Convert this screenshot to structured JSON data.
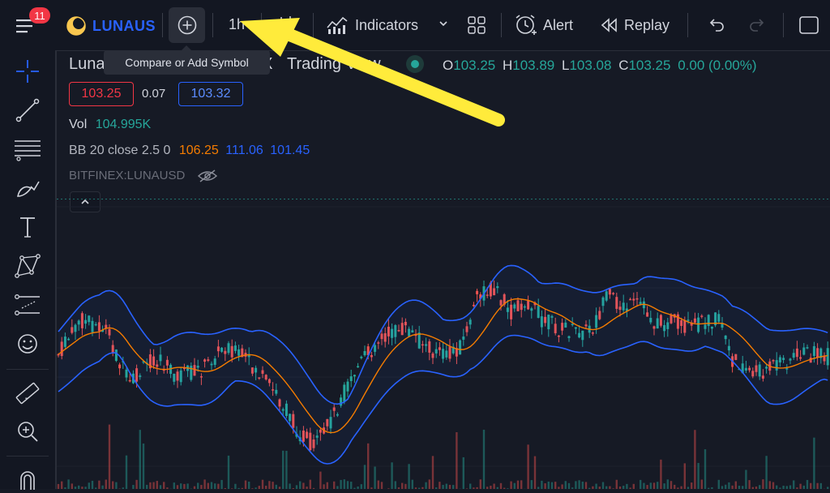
{
  "header": {
    "menu_badge": "11",
    "brand": "LUNAUS",
    "interval": "1h",
    "indicators_label": "Indicators",
    "alert_label": "Alert",
    "replay_label": "Replay",
    "tooltip": "Compare or Add Symbol"
  },
  "legend": {
    "symbol_left": "Luna",
    "symbol_sep": "X",
    "symbol_right": "Trading View",
    "ohlc": {
      "o_label": "O",
      "o": "103.25",
      "h_label": "H",
      "h": "103.89",
      "l_label": "L",
      "l": "103.08",
      "c_label": "C",
      "c": "103.25",
      "change": "0.00 (0.00%)"
    },
    "bid": "103.25",
    "spread": "0.07",
    "ask": "103.32",
    "vol_label": "Vol",
    "vol_value": "104.995K",
    "bb_label": "BB 20 close 2.5 0",
    "bb_basis": "106.25",
    "bb_upper": "111.06",
    "bb_lower": "101.45",
    "source": "BITFINEX:LUNAUSD"
  },
  "colors": {
    "up": "#26a69a",
    "down": "#ef5350",
    "bb_band": "#2962ff",
    "bb_basis": "#f57c00",
    "arrow": "#ffeb3b"
  },
  "icons": {
    "menu": "hamburger-icon",
    "add": "plus-circle-icon",
    "bars": "candles-icon",
    "indicators": "indicators-icon",
    "layout": "grid-icon",
    "alert": "alarm-icon",
    "replay": "rewind-icon",
    "undo": "undo-icon",
    "redo": "redo-icon",
    "fullscreen": "square-icon"
  }
}
